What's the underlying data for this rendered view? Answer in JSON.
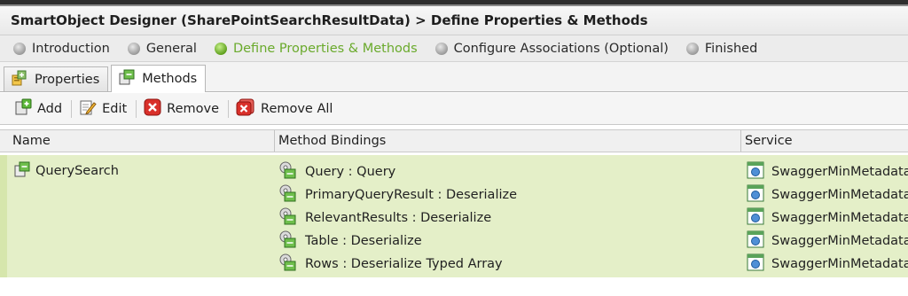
{
  "window": {
    "title": "SmartObject Designer (SharePointSearchResultData) > Define Properties & Methods"
  },
  "wizard": {
    "steps": [
      {
        "label": "Introduction",
        "active": false
      },
      {
        "label": "General",
        "active": false
      },
      {
        "label": "Define Properties & Methods",
        "active": true
      },
      {
        "label": "Configure Associations (Optional)",
        "active": false
      },
      {
        "label": "Finished",
        "active": false
      }
    ],
    "active_color": "#6aaa2c"
  },
  "tabs": [
    {
      "label": "Properties",
      "icon": "properties-icon",
      "selected": false
    },
    {
      "label": "Methods",
      "icon": "methods-icon",
      "selected": true
    }
  ],
  "toolbar": {
    "add_label": "Add",
    "edit_label": "Edit",
    "remove_label": "Remove",
    "remove_all_label": "Remove All"
  },
  "grid": {
    "columns": [
      "Name",
      "Method Bindings",
      "Service"
    ],
    "rows": [
      {
        "name": "QuerySearch",
        "bindings": [
          "Query : Query",
          "PrimaryQueryResult : Deserialize",
          "RelevantResults : Deserialize",
          "Table : Deserialize",
          "Rows : Deserialize Typed Array"
        ],
        "services": [
          "SwaggerMinMetadata",
          "SwaggerMinMetadata",
          "SwaggerMinMetadata",
          "SwaggerMinMetadata",
          "SwaggerMinMetadata"
        ],
        "selected": true
      }
    ],
    "selected_row_color": "#e4efc8"
  }
}
